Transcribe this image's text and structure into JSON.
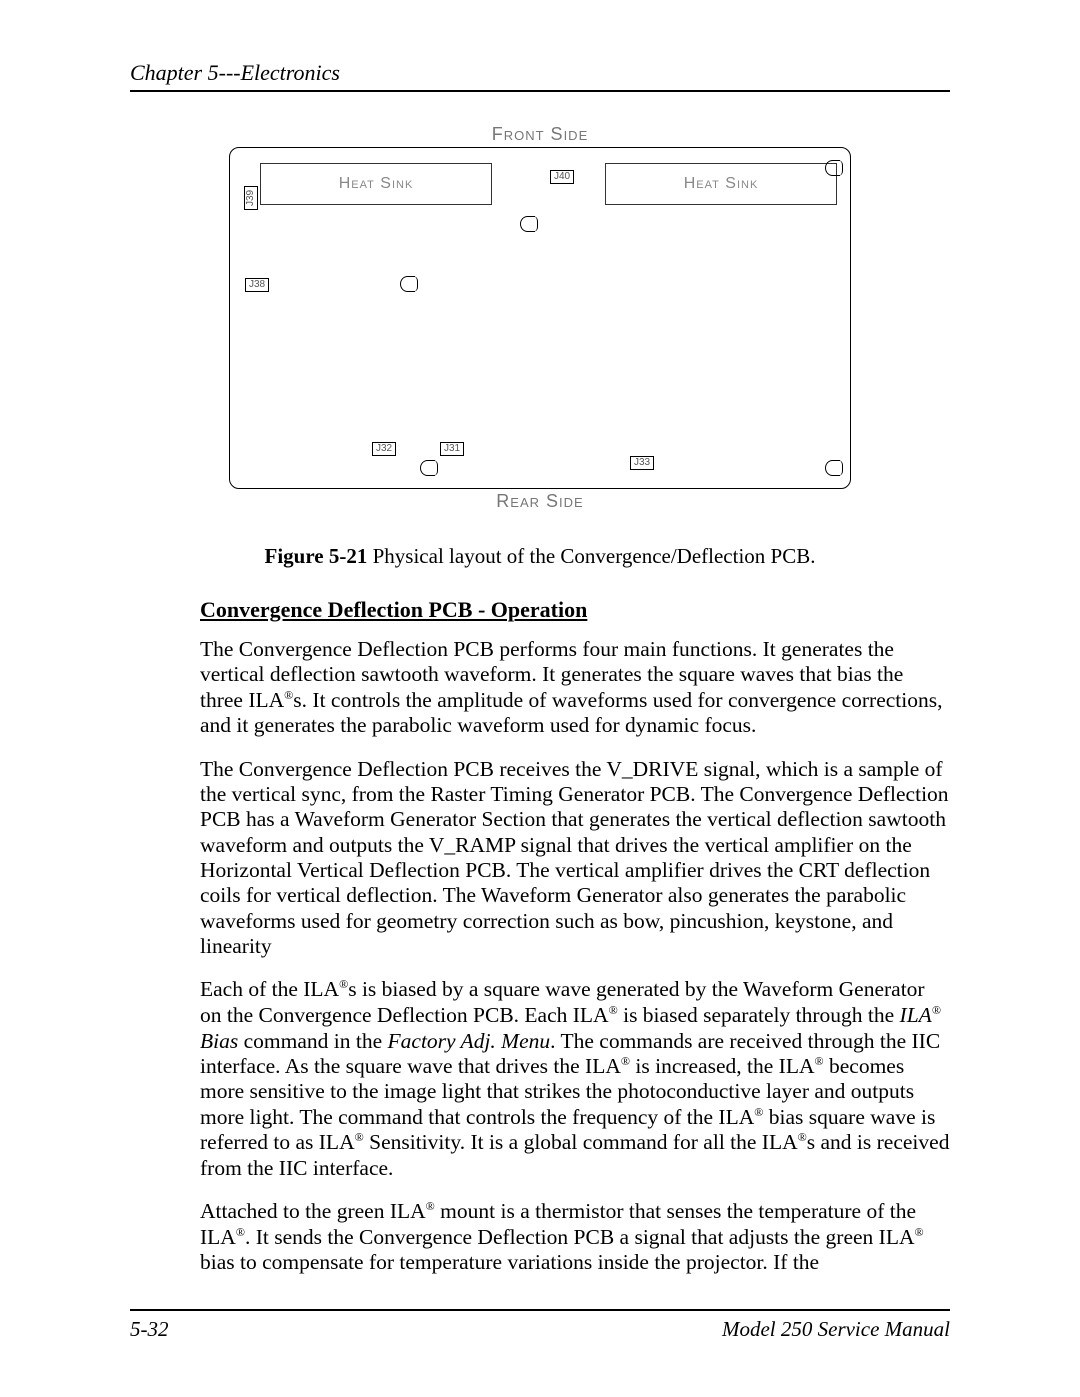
{
  "header": "Chapter 5---Electronics",
  "figure": {
    "front": "Front Side",
    "rear": "Rear Side",
    "heatsink_left": "Heat Sink",
    "heatsink_right": "Heat Sink",
    "j39": "J39",
    "j40": "J40",
    "j38": "J38",
    "j32": "J32",
    "j31": "J31",
    "j33": "J33"
  },
  "caption_bold": "Figure 5-21",
  "caption_rest": "  Physical layout of the Convergence/Deflection PCB.",
  "section_title": "Convergence Deflection PCB  - Operation",
  "p1a": "The Convergence Deflection PCB performs four main functions. It generates the vertical deflection sawtooth waveform. It generates the square waves that bias the three ILA",
  "p1b": "s. It controls the amplitude of waveforms used for convergence corrections, and it generates the parabolic waveform used for dynamic focus.",
  "p2": "The Convergence Deflection PCB receives the V_DRIVE signal, which is a sample of the vertical sync, from the Raster Timing Generator PCB. The Convergence Deflection PCB has a Waveform Generator Section that generates the vertical deflection sawtooth waveform and outputs the V_RAMP signal that drives the vertical amplifier on the Horizontal Vertical Deflection PCB. The vertical amplifier drives the CRT deflection coils for vertical deflection. The Waveform Generator also generates the parabolic waveforms used for geometry correction such as bow, pincushion, keystone, and linearity",
  "p3a": "Each of the ILA",
  "p3b": "s is biased by a square wave generated by the Waveform Generator on the Convergence Deflection PCB. Each ILA",
  "p3c": " is biased separately through the ",
  "p3_ital1a": "ILA",
  "p3_ital1b": " Bias",
  "p3d": " command in the ",
  "p3_ital2": "Factory Adj. Menu",
  "p3e": ". The commands are received through the IIC interface. As the square wave that drives the ILA",
  "p3f": " is increased, the ILA",
  "p3g": " becomes more sensitive to the image light that strikes the photoconductive layer and outputs more light. The command that controls the frequency of the ILA",
  "p3h": " bias square wave is referred to as ILA",
  "p3i": " Sensitivity. It is a global command for all the ILA",
  "p3j": "s and is received from the IIC interface.",
  "p4a": "Attached to the green ILA",
  "p4b": " mount is a thermistor that senses the temperature of the ILA",
  "p4c": ". It sends the Convergence Deflection PCB a signal that adjusts the green ILA",
  "p4d": " bias to compensate for temperature variations inside the projector. If the",
  "footer_left": "5-32",
  "footer_right": "Model 250 Service Manual",
  "reg": "®"
}
